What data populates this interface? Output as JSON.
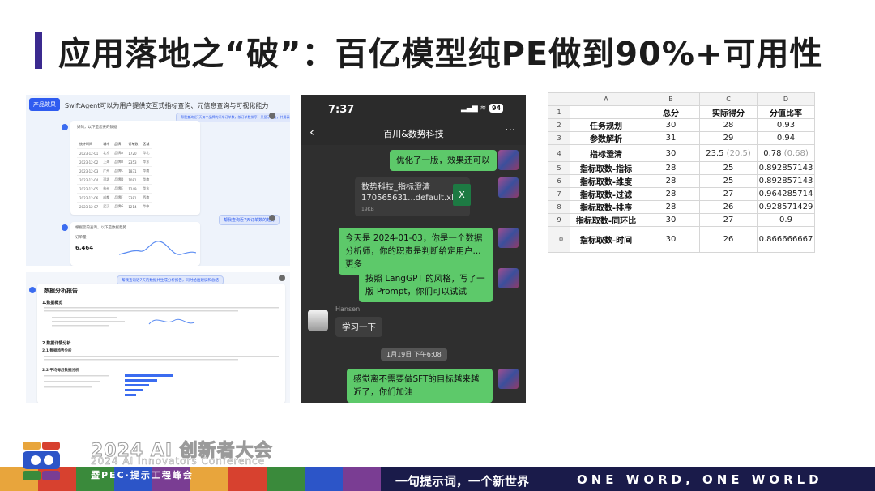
{
  "title": "应用落地之“破”：百亿模型纯PE做到90%+可用性",
  "panel1": {
    "tag": "产品效果",
    "headline": "SwiftAgent可以为用户提供交互式指标查询、元信息查询与可视化能力",
    "bubble1": "帮我查询近7天每个品牌的汽车订单数，按订单数排序，只显示前五，并用表格展示数据",
    "card_intro": "好的，以下是您要的数据",
    "table": [
      [
        "统计时间",
        "城市",
        "品牌",
        "订单数",
        "区域"
      ],
      [
        "2023-12-01",
        "北京",
        "品牌A",
        "1720",
        "华北"
      ],
      [
        "2023-12-02",
        "上海",
        "品牌B",
        "2353",
        "华东"
      ],
      [
        "2023-12-03",
        "广州",
        "品牌C",
        "1831",
        "华南"
      ],
      [
        "2023-12-04",
        "深圳",
        "品牌D",
        "1081",
        "华南"
      ],
      [
        "2023-12-05",
        "杭州",
        "品牌E",
        "1249",
        "华东"
      ],
      [
        "2023-12-06",
        "成都",
        "品牌F",
        "2381",
        "西南"
      ],
      [
        "2023-12-07",
        "武汉",
        "品牌G",
        "1214",
        "华中"
      ]
    ],
    "bubble2": "帮我查询近7天订单数的趋势",
    "card2_intro": "根据您的查询，以下是数据趋势",
    "card2_label": "订单量",
    "card2_value": "6,464",
    "bubble3": "帮我查询近7天的数据并生成分析报告，同时给出建议和总结"
  },
  "panel2": {
    "report_title": "数据分析报告",
    "section1": "1.数据概览",
    "section2": "2.数据详情分析",
    "sub1": "2.1 数据趋势分析",
    "sub2": "2.2 平均每月数据分析"
  },
  "phone": {
    "time": "7:37",
    "signal": "▂▄▆ ≋",
    "battery": "94",
    "back": "‹",
    "chat_name": "百川&数势科技",
    "more": "···",
    "msg1": "优化了一版，效果还可以",
    "file_name": "数势科技_指标澄清170565631...default.xlsx",
    "file_size": "19KB",
    "file_icon": "X",
    "msg2": "今天是 2024-01-03，你是一个数据分析师，你的职责是判断给定用户...更多",
    "msg3": "按照 LangGPT 的风格，写了一版 Prompt，你们可以试试",
    "sender": "Hansen",
    "msg4": "学习一下",
    "timestamp": "1月19日 下午6:08",
    "msg5": "感觉离不需要做SFT的目标越来越近了，你们加油"
  },
  "sheet": {
    "col_headers": [
      "A",
      "B",
      "C",
      "D"
    ],
    "rows": [
      {
        "n": "1",
        "a": "",
        "b": "总分",
        "c": "实际得分",
        "d": "分值比率"
      },
      {
        "n": "2",
        "a": "任务规划",
        "b": "30",
        "c": "28",
        "d": "0.93"
      },
      {
        "n": "3",
        "a": "参数解析",
        "b": "31",
        "c": "29",
        "d": "0.94"
      },
      {
        "n": "4",
        "a": "指标澄清",
        "b": "30",
        "c": "23.5",
        "c2": "(20.5)",
        "d": "0.78",
        "d2": "(0.68)"
      },
      {
        "n": "5",
        "a": "指标取数-指标",
        "b": "28",
        "c": "25",
        "d": "0.892857143"
      },
      {
        "n": "6",
        "a": "指标取数-维度",
        "b": "28",
        "c": "25",
        "d": "0.892857143"
      },
      {
        "n": "7",
        "a": "指标取数-过滤",
        "b": "28",
        "c": "27",
        "d": "0.964285714"
      },
      {
        "n": "8",
        "a": "指标取数-排序",
        "b": "28",
        "c": "26",
        "d": "0.928571429"
      },
      {
        "n": "9",
        "a": "指标取数-同环比",
        "b": "30",
        "c": "27",
        "d": "0.9"
      },
      {
        "n": "10",
        "a": "指标取数-时间",
        "b": "30",
        "c": "26",
        "d": "0.866666667"
      }
    ]
  },
  "footer": {
    "conf_cn": "2024 AI 创新者大会",
    "conf_en": "2024 AI Innovators Conference",
    "conf_sub": "暨PEC·提示工程峰会",
    "slogan_cn": "一句提示词，一个新世界",
    "slogan_en": "ONE WORD, ONE WORLD",
    "stripe_colors": [
      "#e8a53c",
      "#d7412f",
      "#3a8a3b",
      "#2c55c8",
      "#7a3d93",
      "#e8a53c",
      "#d7412f",
      "#3a8a3b",
      "#2c55c8",
      "#7a3d93"
    ]
  }
}
